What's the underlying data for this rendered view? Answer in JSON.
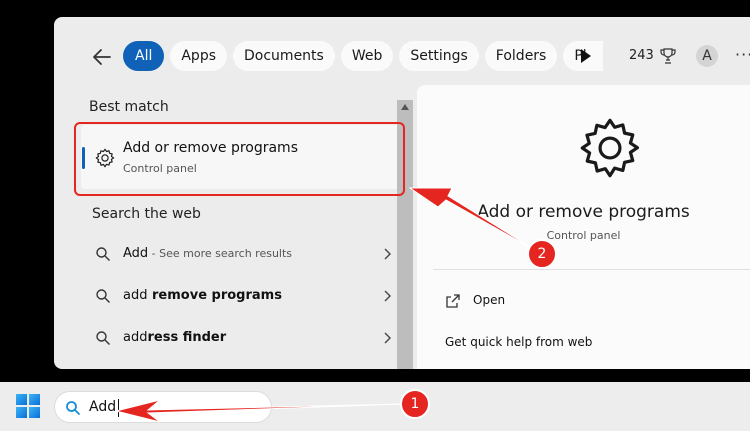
{
  "topbar": {
    "chips": [
      {
        "label": "All",
        "active": true
      },
      {
        "label": "Apps"
      },
      {
        "label": "Documents"
      },
      {
        "label": "Web"
      },
      {
        "label": "Settings"
      },
      {
        "label": "Folders"
      },
      {
        "label": "Pł"
      }
    ],
    "points": "243",
    "avatar_letter": "A",
    "more_label": "···"
  },
  "results": {
    "best_match_heading": "Best match",
    "best_match": {
      "title": "Add or remove programs",
      "subtitle": "Control panel"
    },
    "web_heading": "Search the web",
    "web_rows": [
      {
        "prefix": "Add",
        "suffix": "",
        "hint": " - See more search results"
      },
      {
        "prefix": "add",
        "suffix": " remove programs",
        "hint": ""
      },
      {
        "prefix": "add",
        "suffix": "ress finder",
        "hint": ""
      }
    ]
  },
  "detail": {
    "title": "Add or remove programs",
    "subtitle": "Control panel",
    "open_label": "Open",
    "help_label": "Get quick help from web"
  },
  "taskbar": {
    "search_value": "Add"
  },
  "annotations": {
    "step1": "1",
    "step2": "2",
    "color": "#e52620"
  },
  "colors": {
    "accent": "#0f62b8"
  }
}
